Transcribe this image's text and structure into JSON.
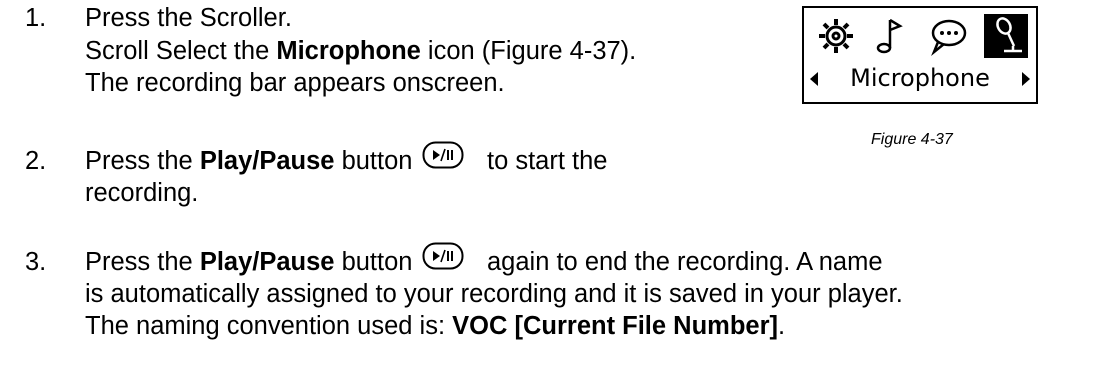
{
  "steps": [
    {
      "number": "1.",
      "lines": [
        {
          "text": "Press the Scroller."
        },
        {
          "pre": "Scroll Select the ",
          "bold": "Microphone",
          "post": " icon (Figure 4-37)."
        },
        {
          "text": "The recording bar appears onscreen."
        }
      ]
    },
    {
      "number": "2.",
      "line1_pre": "Press the ",
      "line1_bold": "Play/Pause",
      "line1_mid": " button",
      "line1_post": "to start the",
      "line2": "recording."
    },
    {
      "number": "3.",
      "line1_pre": "Press the ",
      "line1_bold": "Play/Pause",
      "line1_mid": " button",
      "line1_post": "again to end the recording. A name",
      "line2": "is automatically assigned to your recording and it is saved in your player.",
      "line3_pre": "The naming convention used is: ",
      "line3_bold": "VOC [Current File Number]",
      "line3_post": "."
    }
  ],
  "figure": {
    "screen_label": "Microphone",
    "icons": [
      "settings-icon",
      "music-note-icon",
      "speech-bubble-icon",
      "microphone-icon"
    ],
    "selected_icon": "microphone-icon",
    "caption": "Figure 4-37"
  },
  "button_glyph": "►/II"
}
